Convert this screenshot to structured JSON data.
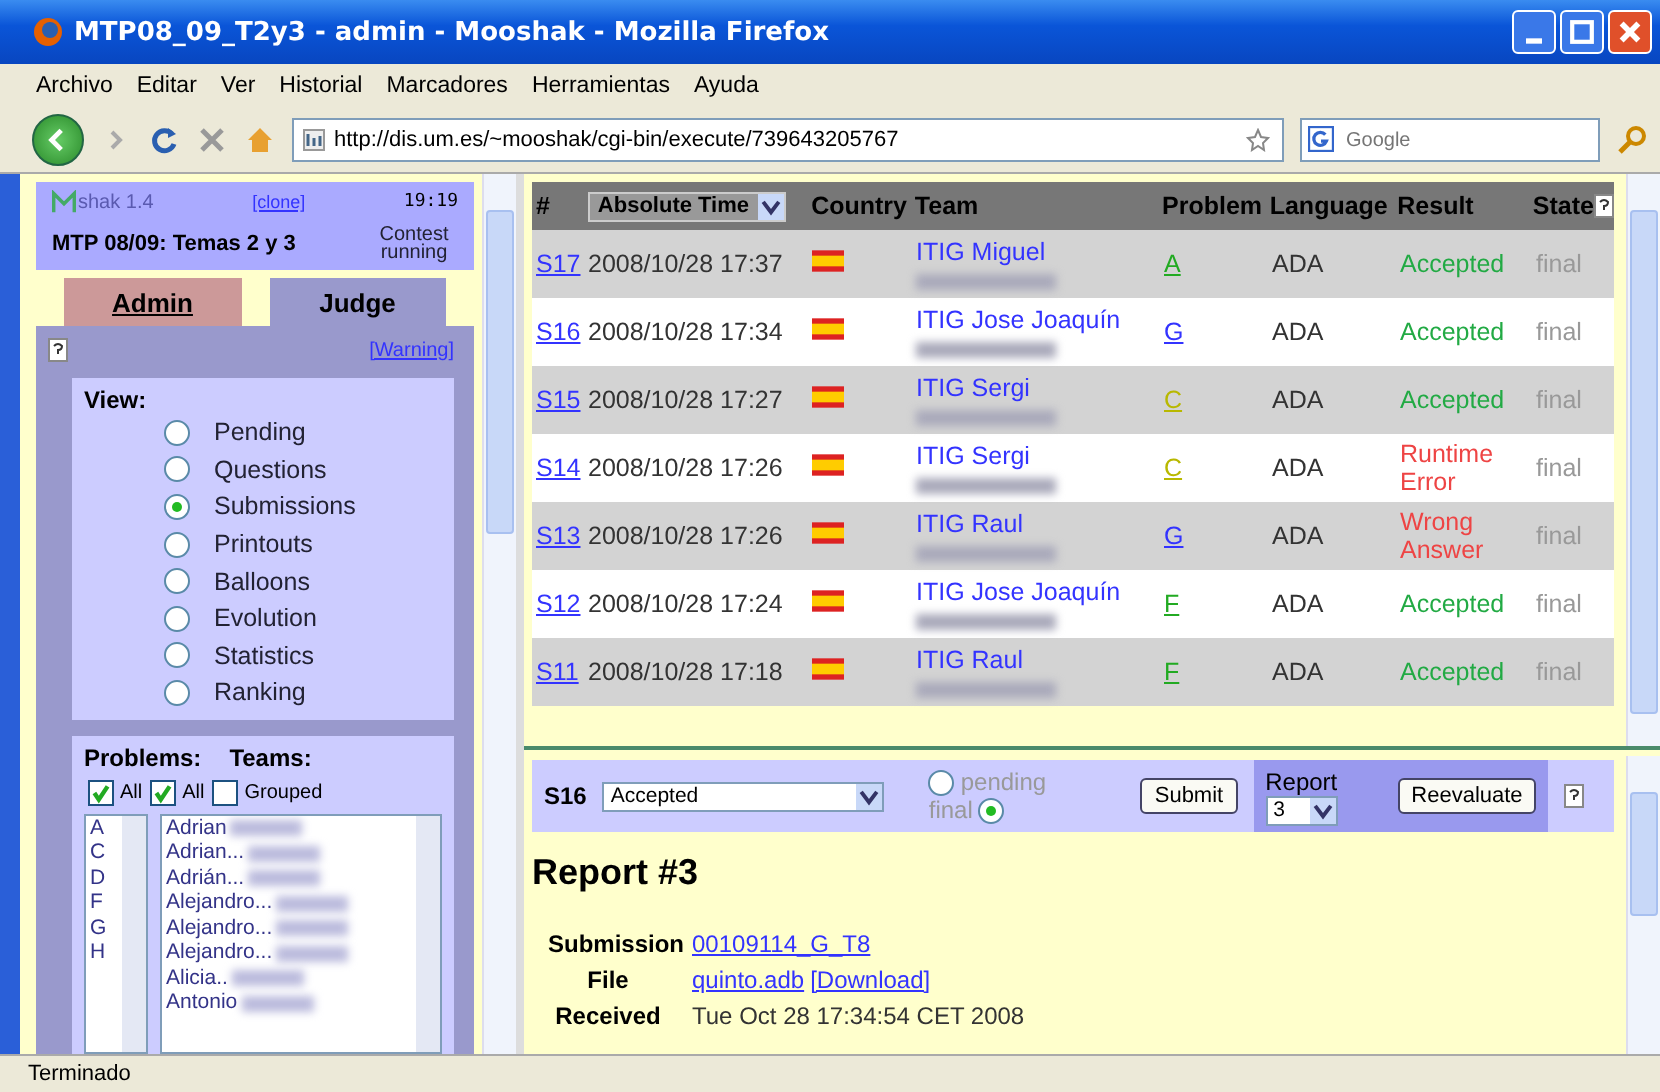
{
  "window": {
    "title": "MTP08_09_T2y3 - admin - Mooshak - Mozilla Firefox"
  },
  "menu": [
    "Archivo",
    "Editar",
    "Ver",
    "Historial",
    "Marcadores",
    "Herramientas",
    "Ayuda"
  ],
  "navbar": {
    "url": "http://dis.um.es/~mooshak/cgi-bin/execute/739643205767",
    "search_placeholder": "Google"
  },
  "sidebar": {
    "logo": "shak 1.4",
    "clone_link": "[clone]",
    "time": "19:19",
    "contest": "MTP 08/09: Temas 2 y 3",
    "contest_status": "Contest running",
    "tabs": [
      {
        "label": "Admin",
        "selected": false
      },
      {
        "label": "Judge",
        "selected": true
      }
    ],
    "warning_link": "[Warning]",
    "view_label": "View:",
    "view_options": [
      {
        "label": "Pending",
        "selected": false
      },
      {
        "label": "Questions",
        "selected": false
      },
      {
        "label": "Submissions",
        "selected": true
      },
      {
        "label": "Printouts",
        "selected": false
      },
      {
        "label": "Balloons",
        "selected": false
      },
      {
        "label": "Evolution",
        "selected": false
      },
      {
        "label": "Statistics",
        "selected": false
      },
      {
        "label": "Ranking",
        "selected": false
      }
    ],
    "problems_label": "Problems:",
    "teams_label": "Teams:",
    "filters": [
      {
        "label": "All",
        "checked": true
      },
      {
        "label": "All",
        "checked": true
      },
      {
        "label": "Grouped",
        "checked": false
      }
    ],
    "problems": [
      "A",
      "C",
      "D",
      "F",
      "G",
      "H"
    ],
    "teams": [
      "Adrian",
      "Adrian...",
      "Adrián...",
      "Alejandro...",
      "Alejandro...",
      "Alejandro...",
      "Alicia..",
      "Antonio"
    ]
  },
  "table": {
    "columns": [
      "#",
      "Absolute Time",
      "Country",
      "Team",
      "Problem",
      "Language",
      "Result",
      "State"
    ],
    "rows": [
      {
        "id": "S17",
        "time": "2008/10/28 17:37",
        "team": "ITIG Miguel",
        "problem": "A",
        "color": "#22aa22",
        "language": "ADA",
        "result": {
          "text": "Accepted",
          "color": "#22aa44"
        },
        "state": "final"
      },
      {
        "id": "S16",
        "time": "2008/10/28 17:34",
        "team": "ITIG Jose Joaquín",
        "problem": "G",
        "color": "#3333ff",
        "language": "ADA",
        "result": {
          "text": "Accepted",
          "color": "#22aa44"
        },
        "state": "final"
      },
      {
        "id": "S15",
        "time": "2008/10/28 17:27",
        "team": "ITIG Sergi",
        "problem": "C",
        "color": "#b8b800",
        "language": "ADA",
        "result": {
          "text": "Accepted",
          "color": "#22aa44"
        },
        "state": "final"
      },
      {
        "id": "S14",
        "time": "2008/10/28 17:26",
        "team": "ITIG Sergi",
        "problem": "C",
        "color": "#b8b800",
        "language": "ADA",
        "result": {
          "text": "Runtime Error",
          "color": "#ee4444"
        },
        "state": "final"
      },
      {
        "id": "S13",
        "time": "2008/10/28 17:26",
        "team": "ITIG Raul",
        "problem": "G",
        "color": "#3333ff",
        "language": "ADA",
        "result": {
          "text": "Wrong Answer",
          "color": "#ee4444"
        },
        "state": "final"
      },
      {
        "id": "S12",
        "time": "2008/10/28 17:24",
        "team": "ITIG Jose Joaquín",
        "problem": "F",
        "color": "#22aa22",
        "language": "ADA",
        "result": {
          "text": "Accepted",
          "color": "#22aa44"
        },
        "state": "final"
      },
      {
        "id": "S11",
        "time": "2008/10/28 17:18",
        "team": "ITIG Raul",
        "problem": "F",
        "color": "#22aa22",
        "language": "ADA",
        "result": {
          "text": "Accepted",
          "color": "#22aa44"
        },
        "state": "final"
      }
    ]
  },
  "judge_bar": {
    "submission": "S16",
    "result_select": "Accepted",
    "radios": [
      {
        "label": "pending",
        "selected": false
      },
      {
        "label": "final",
        "selected": true
      }
    ],
    "submit": "Submit",
    "report_label": "Report",
    "report_select": "3",
    "reevaluate": "Reevaluate"
  },
  "report": {
    "title": "Report #3",
    "fields": [
      {
        "label": "Submission",
        "parts": [
          {
            "text": "00109114_G_T8",
            "link": true
          }
        ]
      },
      {
        "label": "File",
        "parts": [
          {
            "text": "quinto.adb",
            "link": true
          },
          {
            "text": "[Download]",
            "link": true
          }
        ]
      },
      {
        "label": "Received",
        "parts": [
          {
            "text": "Tue Oct 28 17:34:54 CET 2008",
            "link": false
          }
        ]
      }
    ]
  },
  "status_bar": "Terminado"
}
